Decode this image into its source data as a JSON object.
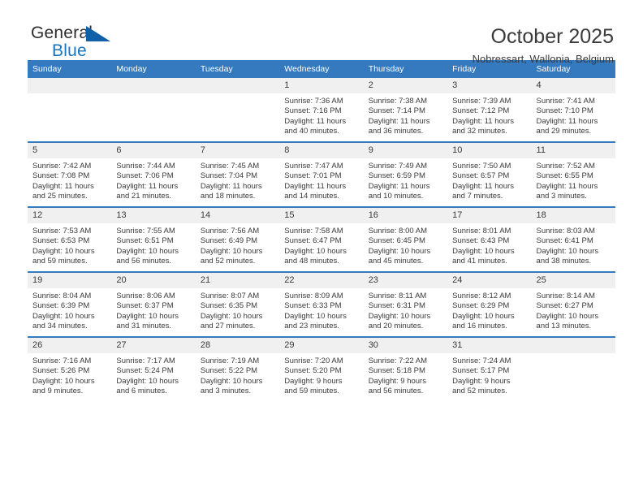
{
  "brand": {
    "name_top": "General",
    "name_bottom": "Blue",
    "triangle_color": "#1060a8",
    "blue_color": "#1b75bb"
  },
  "header": {
    "title": "October 2025",
    "subtitle": "Nobressart, Wallonia, Belgium",
    "header_bg": "#3579bf",
    "header_text": "#ffffff",
    "daynum_bg": "#f0f0f0"
  },
  "weekday_headers": [
    "Sunday",
    "Monday",
    "Tuesday",
    "Wednesday",
    "Thursday",
    "Friday",
    "Saturday"
  ],
  "labels": {
    "sunrise_prefix": "Sunrise:",
    "sunset_prefix": "Sunset:",
    "daylight_prefix": "Daylight:"
  },
  "weeks": [
    [
      {
        "day": "",
        "lines": []
      },
      {
        "day": "",
        "lines": []
      },
      {
        "day": "",
        "lines": []
      },
      {
        "day": "1",
        "lines": [
          "Sunrise: 7:36 AM",
          "Sunset: 7:16 PM",
          "Daylight: 11 hours",
          "and 40 minutes."
        ]
      },
      {
        "day": "2",
        "lines": [
          "Sunrise: 7:38 AM",
          "Sunset: 7:14 PM",
          "Daylight: 11 hours",
          "and 36 minutes."
        ]
      },
      {
        "day": "3",
        "lines": [
          "Sunrise: 7:39 AM",
          "Sunset: 7:12 PM",
          "Daylight: 11 hours",
          "and 32 minutes."
        ]
      },
      {
        "day": "4",
        "lines": [
          "Sunrise: 7:41 AM",
          "Sunset: 7:10 PM",
          "Daylight: 11 hours",
          "and 29 minutes."
        ]
      }
    ],
    [
      {
        "day": "5",
        "lines": [
          "Sunrise: 7:42 AM",
          "Sunset: 7:08 PM",
          "Daylight: 11 hours",
          "and 25 minutes."
        ]
      },
      {
        "day": "6",
        "lines": [
          "Sunrise: 7:44 AM",
          "Sunset: 7:06 PM",
          "Daylight: 11 hours",
          "and 21 minutes."
        ]
      },
      {
        "day": "7",
        "lines": [
          "Sunrise: 7:45 AM",
          "Sunset: 7:04 PM",
          "Daylight: 11 hours",
          "and 18 minutes."
        ]
      },
      {
        "day": "8",
        "lines": [
          "Sunrise: 7:47 AM",
          "Sunset: 7:01 PM",
          "Daylight: 11 hours",
          "and 14 minutes."
        ]
      },
      {
        "day": "9",
        "lines": [
          "Sunrise: 7:49 AM",
          "Sunset: 6:59 PM",
          "Daylight: 11 hours",
          "and 10 minutes."
        ]
      },
      {
        "day": "10",
        "lines": [
          "Sunrise: 7:50 AM",
          "Sunset: 6:57 PM",
          "Daylight: 11 hours",
          "and 7 minutes."
        ]
      },
      {
        "day": "11",
        "lines": [
          "Sunrise: 7:52 AM",
          "Sunset: 6:55 PM",
          "Daylight: 11 hours",
          "and 3 minutes."
        ]
      }
    ],
    [
      {
        "day": "12",
        "lines": [
          "Sunrise: 7:53 AM",
          "Sunset: 6:53 PM",
          "Daylight: 10 hours",
          "and 59 minutes."
        ]
      },
      {
        "day": "13",
        "lines": [
          "Sunrise: 7:55 AM",
          "Sunset: 6:51 PM",
          "Daylight: 10 hours",
          "and 56 minutes."
        ]
      },
      {
        "day": "14",
        "lines": [
          "Sunrise: 7:56 AM",
          "Sunset: 6:49 PM",
          "Daylight: 10 hours",
          "and 52 minutes."
        ]
      },
      {
        "day": "15",
        "lines": [
          "Sunrise: 7:58 AM",
          "Sunset: 6:47 PM",
          "Daylight: 10 hours",
          "and 48 minutes."
        ]
      },
      {
        "day": "16",
        "lines": [
          "Sunrise: 8:00 AM",
          "Sunset: 6:45 PM",
          "Daylight: 10 hours",
          "and 45 minutes."
        ]
      },
      {
        "day": "17",
        "lines": [
          "Sunrise: 8:01 AM",
          "Sunset: 6:43 PM",
          "Daylight: 10 hours",
          "and 41 minutes."
        ]
      },
      {
        "day": "18",
        "lines": [
          "Sunrise: 8:03 AM",
          "Sunset: 6:41 PM",
          "Daylight: 10 hours",
          "and 38 minutes."
        ]
      }
    ],
    [
      {
        "day": "19",
        "lines": [
          "Sunrise: 8:04 AM",
          "Sunset: 6:39 PM",
          "Daylight: 10 hours",
          "and 34 minutes."
        ]
      },
      {
        "day": "20",
        "lines": [
          "Sunrise: 8:06 AM",
          "Sunset: 6:37 PM",
          "Daylight: 10 hours",
          "and 31 minutes."
        ]
      },
      {
        "day": "21",
        "lines": [
          "Sunrise: 8:07 AM",
          "Sunset: 6:35 PM",
          "Daylight: 10 hours",
          "and 27 minutes."
        ]
      },
      {
        "day": "22",
        "lines": [
          "Sunrise: 8:09 AM",
          "Sunset: 6:33 PM",
          "Daylight: 10 hours",
          "and 23 minutes."
        ]
      },
      {
        "day": "23",
        "lines": [
          "Sunrise: 8:11 AM",
          "Sunset: 6:31 PM",
          "Daylight: 10 hours",
          "and 20 minutes."
        ]
      },
      {
        "day": "24",
        "lines": [
          "Sunrise: 8:12 AM",
          "Sunset: 6:29 PM",
          "Daylight: 10 hours",
          "and 16 minutes."
        ]
      },
      {
        "day": "25",
        "lines": [
          "Sunrise: 8:14 AM",
          "Sunset: 6:27 PM",
          "Daylight: 10 hours",
          "and 13 minutes."
        ]
      }
    ],
    [
      {
        "day": "26",
        "lines": [
          "Sunrise: 7:16 AM",
          "Sunset: 5:26 PM",
          "Daylight: 10 hours",
          "and 9 minutes."
        ]
      },
      {
        "day": "27",
        "lines": [
          "Sunrise: 7:17 AM",
          "Sunset: 5:24 PM",
          "Daylight: 10 hours",
          "and 6 minutes."
        ]
      },
      {
        "day": "28",
        "lines": [
          "Sunrise: 7:19 AM",
          "Sunset: 5:22 PM",
          "Daylight: 10 hours",
          "and 3 minutes."
        ]
      },
      {
        "day": "29",
        "lines": [
          "Sunrise: 7:20 AM",
          "Sunset: 5:20 PM",
          "Daylight: 9 hours",
          "and 59 minutes."
        ]
      },
      {
        "day": "30",
        "lines": [
          "Sunrise: 7:22 AM",
          "Sunset: 5:18 PM",
          "Daylight: 9 hours",
          "and 56 minutes."
        ]
      },
      {
        "day": "31",
        "lines": [
          "Sunrise: 7:24 AM",
          "Sunset: 5:17 PM",
          "Daylight: 9 hours",
          "and 52 minutes."
        ]
      },
      {
        "day": "",
        "lines": []
      }
    ]
  ]
}
